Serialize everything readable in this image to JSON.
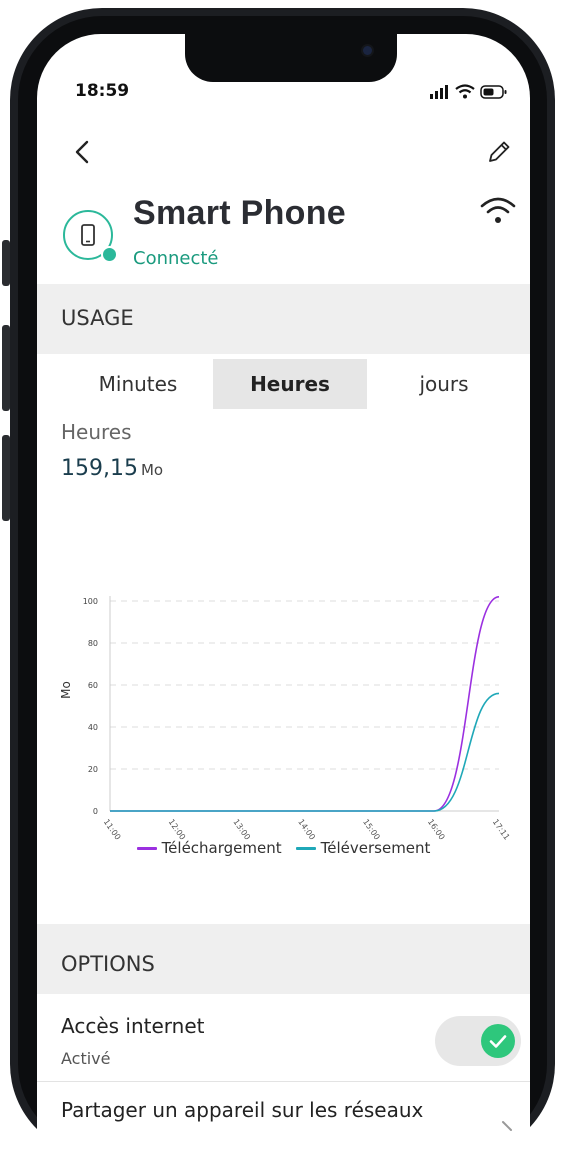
{
  "status_bar": {
    "time": "18:59",
    "signal_icon": "cellular-signal-icon",
    "wifi_icon": "wifi-icon",
    "battery_icon": "battery-icon"
  },
  "nav": {
    "back_icon": "chevron-left-icon",
    "edit_icon": "pencil-icon"
  },
  "device": {
    "name": "Smart Phone",
    "status": "Connecté",
    "icon": "smartphone-icon",
    "connection_icon": "wifi-icon"
  },
  "usage": {
    "section_label": "USAGE",
    "tabs": [
      {
        "label": "Minutes",
        "active": false
      },
      {
        "label": "Heures",
        "active": true
      },
      {
        "label": "jours",
        "active": false
      }
    ],
    "period_label": "Heures",
    "total_value": "159,15",
    "total_unit": "Mo"
  },
  "chart_data": {
    "type": "line",
    "title": "",
    "xlabel": "",
    "ylabel": "Mo",
    "ylim": [
      0,
      100
    ],
    "yticks": [
      "0",
      "20",
      "40",
      "60",
      "80",
      "100"
    ],
    "x": [
      "11:00",
      "12:00",
      "13:00",
      "14:00",
      "15:00",
      "16:00",
      "17:11"
    ],
    "series": [
      {
        "name": "Téléchargement",
        "color": "#9b30e0",
        "values": [
          0,
          0,
          0,
          0,
          0,
          0,
          102
        ]
      },
      {
        "name": "Téléversement",
        "color": "#1fa8b8",
        "values": [
          0,
          0,
          0,
          0,
          0,
          0,
          56
        ]
      }
    ],
    "grid": "horizontal dashed",
    "legend_position": "bottom-center"
  },
  "options": {
    "section_label": "OPTIONS",
    "items": [
      {
        "title": "Accès internet",
        "subtitle": "Activé",
        "toggle_on": true,
        "toggle_icon": "checkmark-icon"
      },
      {
        "title": "Partager un appareil sur les réseaux",
        "chevron_icon": "chevron-right-icon"
      }
    ]
  }
}
